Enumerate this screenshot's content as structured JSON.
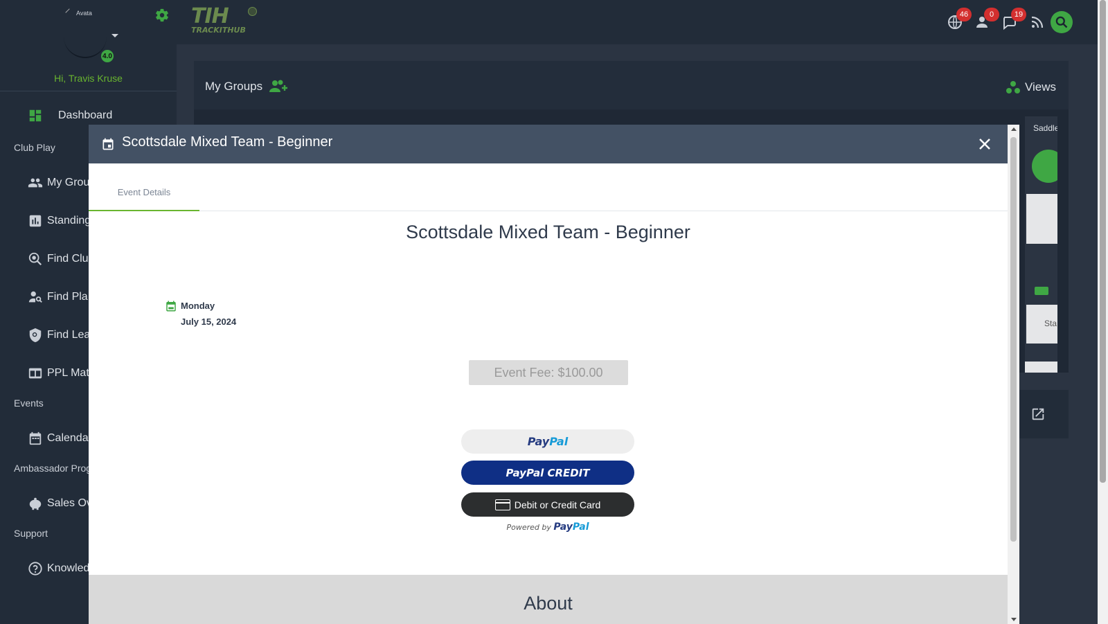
{
  "sidebar": {
    "avatar_alt": "Avata",
    "rating": "4.0",
    "greeting": "Hi, Travis Kruse",
    "dashboard": "Dashboard",
    "sections": {
      "club_play": "Club Play",
      "events": "Events",
      "ambassador": "Ambassador Prog",
      "support": "Support"
    },
    "items": {
      "my_groups": "My Grou",
      "standings": "Standing",
      "find_clubs": "Find Clu",
      "find_players": "Find Pla",
      "find_leagues": "Find Lea",
      "ppl_matches": "PPL Mat",
      "calendar": "Calenda",
      "sales": "Sales Ov",
      "knowledge": "Knowled"
    }
  },
  "topbar": {
    "logo_text": "TIH",
    "logo_sub": "TRACKITHUB",
    "badges": {
      "globe": "46",
      "user": "0",
      "chat": "19"
    }
  },
  "main": {
    "my_groups_title": "My Groups",
    "views_label": "Views",
    "right_strip_title": "Saddle",
    "right_box_text": "Sta"
  },
  "modal": {
    "title": "Scottsdale Mixed Team - Beginner",
    "tab_label": "Event Details",
    "heading": "Scottsdale Mixed Team - Beginner",
    "date_day": "Monday",
    "date_full": "July 15, 2024",
    "fee": "Event Fee: $100.00",
    "paypal_pay": "Pay",
    "paypal_pal": "Pal",
    "paypal_credit": "PayPal CREDIT",
    "card_button": "Debit or Credit Card",
    "powered_prefix": "Powered by",
    "about_heading": "About"
  },
  "colors": {
    "accent": "#69b52f",
    "green_button": "#3fa744",
    "sidebar_bg": "#222c39",
    "modal_header": "#435164",
    "paypal_blue": "#0f2f85"
  }
}
